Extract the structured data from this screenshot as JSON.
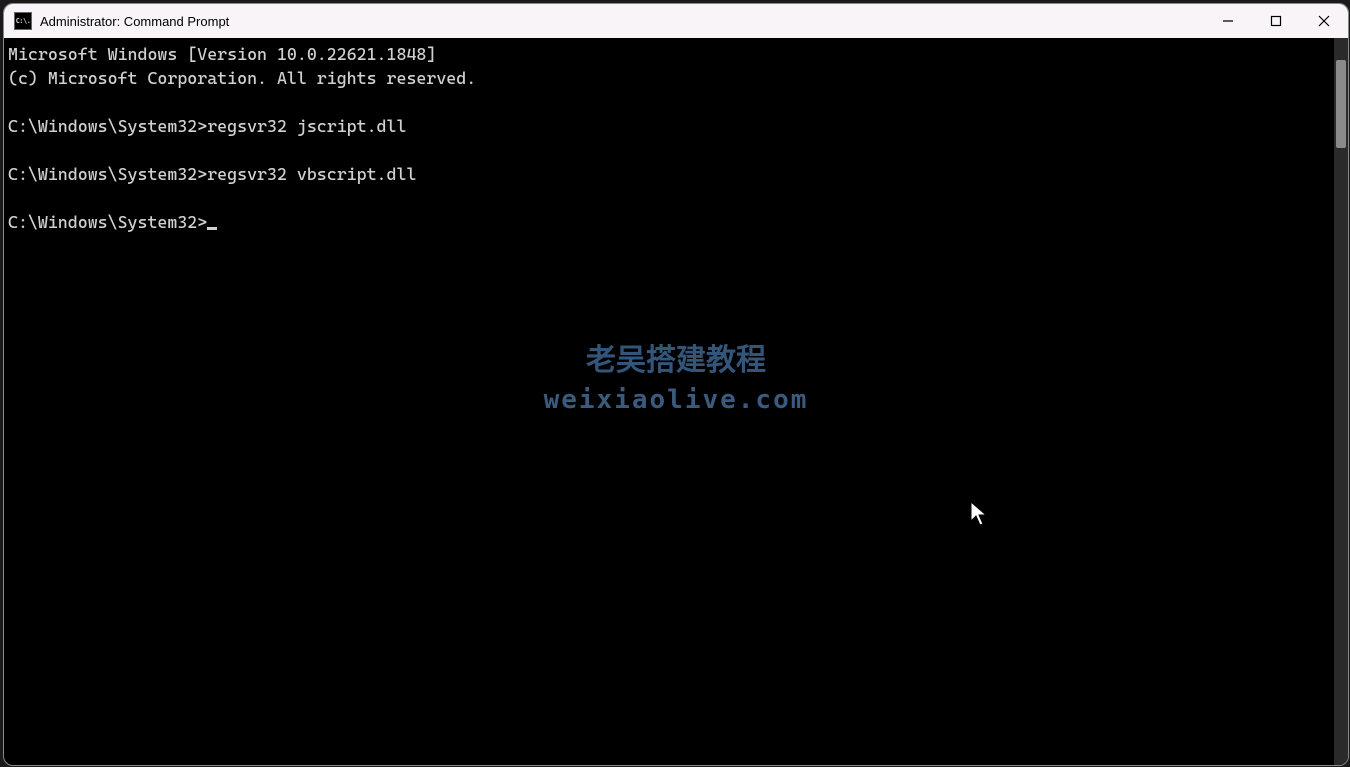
{
  "titlebar": {
    "icon_text": "C:\\.",
    "title": "Administrator: Command Prompt"
  },
  "terminal": {
    "lines": [
      "Microsoft Windows [Version 10.0.22621.1848]",
      "(c) Microsoft Corporation. All rights reserved.",
      "",
      "C:\\Windows\\System32>regsvr32 jscript.dll",
      "",
      "C:\\Windows\\System32>regsvr32 vbscript.dll",
      "",
      "C:\\Windows\\System32>"
    ],
    "cursor_on_last_line": true
  },
  "watermark": {
    "line1": "老吴搭建教程",
    "line2": "weixiaolive.com"
  }
}
